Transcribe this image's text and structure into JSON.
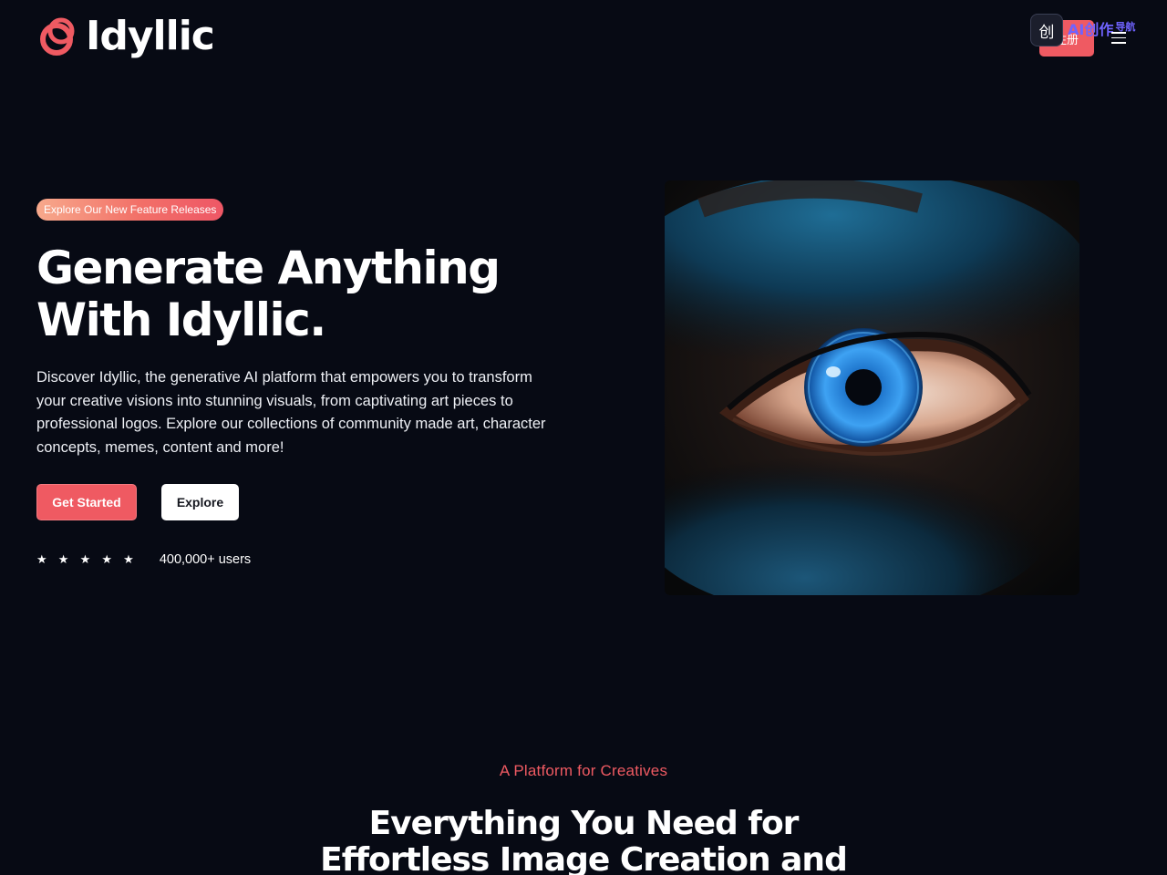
{
  "header": {
    "logo_text": "Idyllic",
    "register_label": "注册",
    "overlay_badge": {
      "icon_text": "创",
      "text": "AI创作",
      "suffix": "导航"
    }
  },
  "hero": {
    "pill_label": "Explore Our New Feature Releases",
    "title": "Generate Anything With Idyllic.",
    "description": "Discover Idyllic, the generative AI platform that empowers you to transform your creative visions into stunning visuals, from captivating art pieces to professional logos. Explore our collections of community made art, character concepts, memes, content and more!",
    "primary_button": "Get Started",
    "secondary_button": "Explore",
    "rating": {
      "stars": "★ ★ ★ ★ ★",
      "users_label": "400,000+ users"
    },
    "image": "blue-eye-closeup-image"
  },
  "section": {
    "eyebrow": "A Platform for Creatives",
    "title": "Everything You Need for Effortless Image Creation and"
  },
  "colors": {
    "background": "#070a14",
    "accent": "#ef5a62",
    "text": "#ffffff"
  }
}
